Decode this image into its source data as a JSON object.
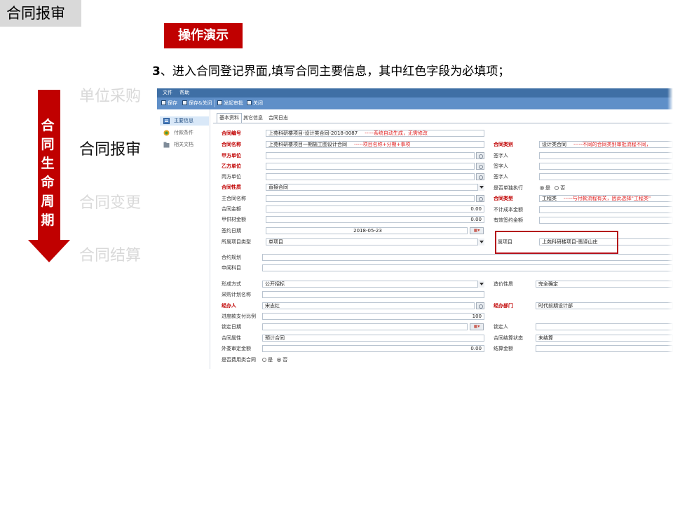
{
  "slide": {
    "title": "合同报审",
    "demo_badge": "操作演示",
    "instruction_num": "3",
    "instruction_text": "、进入合同登记界面,填写合同主要信息，其中红色字段为必填项；",
    "lifecycle": [
      "合",
      "同",
      "生",
      "命",
      "周",
      "期"
    ],
    "steps": [
      "单位采购",
      "合同报审",
      "合同变更",
      "合同结算"
    ],
    "active_step": 1,
    "colors": {
      "accent": "#c00000",
      "arrow": "#c00000",
      "inactive_step": "#d9d9d9",
      "title_bg": "#d9d9d9"
    }
  },
  "app": {
    "menu": [
      "文件",
      "帮助"
    ],
    "toolbar": [
      "保存",
      "保存&关闭",
      "发起审批",
      "关闭"
    ],
    "sidebar": [
      "主要信息",
      "付款条件",
      "相关文档"
    ],
    "tabs": [
      "基本资料",
      "其它信息",
      "合同日志"
    ],
    "fields": {
      "contract_no_label": "合同编号",
      "contract_no_value": "上苑科研楼项目-设计类合同-2018-0087",
      "contract_no_note": "-----系统自动生成，无需修改",
      "contract_name_label": "合同名称",
      "contract_name_value": "上苑科研楼项目一期施工图设计合同",
      "contract_name_note": "-----项目名称+分期+事项",
      "party_a_label": "甲方单位",
      "party_b_label": "乙方单位",
      "party_c_label": "丙方单位",
      "nature_label": "合同性质",
      "nature_value": "直接合同",
      "main_contract_label": "主合同名称",
      "amount_label": "合同金额",
      "amount_value": "0.00",
      "supply_label": "甲供材金额",
      "supply_value": "0.00",
      "sign_date_label": "签约日期",
      "sign_date_value": "2018-05-23",
      "project_type_label": "所属项目类型",
      "project_type_value": "单项目",
      "category_label": "合同类别",
      "category_value": "设计类合同",
      "category_note": "-----不同的合同类别审批流程不同，",
      "signer_1": "签字人",
      "signer_2": "签字人",
      "signer_3": "签字人",
      "single_exec_label": "是否单独执行",
      "yes": "是",
      "no": "否",
      "contract_type_label": "合同类型",
      "contract_type_value": "工程类",
      "contract_type_note": "-----与付款流程有关，因此选择\"工程类\"",
      "excl_cost_label": "不计成本金额",
      "valid_amount_label": "有效签约金额",
      "project_label": "所属项目",
      "project_label_visible": "属项目",
      "project_value": "上苑科研楼项目-翡译山庄",
      "plan_label": "合约规划",
      "subject_label": "申闻科目",
      "form_label": "形成方式",
      "form_value": "公开招标",
      "price_label": "造价性质",
      "price_value": "完全确定",
      "purchase_plan_label": "采购计划名称",
      "handler_label": "经办人",
      "handler_value": "宋志红",
      "dept_label": "经办部门",
      "dept_value": "时代前期设计部",
      "progress_label": "进度款支付比例",
      "progress_value": "100",
      "lock_date_label": "锁定日期",
      "locker_label": "锁定人",
      "attr_label": "合同属性",
      "attr_value": "预计合同",
      "settle_status_label": "合同结算状态",
      "settle_status_value": "未结算",
      "outside_label": "外委审定金额",
      "outside_value": "0.00",
      "settle_amount_label": "结算金额",
      "fee_contract_label": "是否费用类合同",
      "fee_yes": "是",
      "fee_no": "否"
    }
  }
}
